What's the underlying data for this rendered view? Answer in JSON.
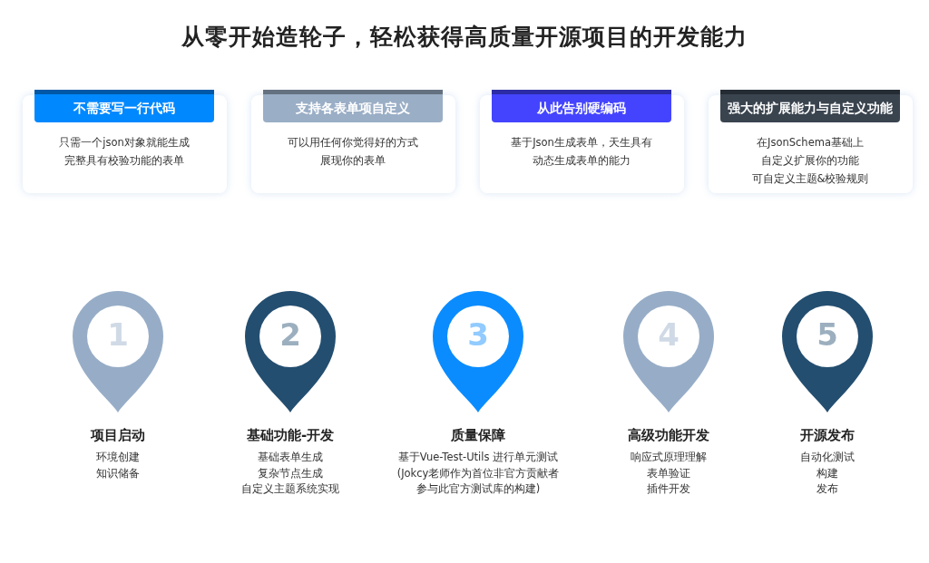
{
  "title": "从零开始造轮子，轻松获得高质量开源项目的开发能力",
  "features": [
    {
      "heading": "不需要写一行代码",
      "color": "#0088ff",
      "lines": [
        "只需一个json对象就能生成",
        "完整具有校验功能的表单"
      ]
    },
    {
      "heading": "支持各表单项自定义",
      "color": "#9aaec6",
      "lines": [
        "可以用任何你觉得好的方式",
        "展现你的表单"
      ]
    },
    {
      "heading": "从此告别硬编码",
      "color": "#4444ff",
      "lines": [
        "基于Json生成表单，天生具有",
        "动态生成表单的能力"
      ]
    },
    {
      "heading": "强大的扩展能力与自定义功能",
      "color": "#3a444f",
      "lines": [
        "在JsonSchema基础上",
        "自定义扩展你的功能",
        "可自定义主题&校验规则"
      ]
    }
  ],
  "steps": [
    {
      "number": "1",
      "color": "#97adc7",
      "title": "项目启动",
      "lines": [
        "环境创建",
        "知识储备"
      ]
    },
    {
      "number": "2",
      "color": "#234e70",
      "title": "基础功能-开发",
      "lines": [
        "基础表单生成",
        "复杂节点生成",
        "自定义主题系统实现"
      ]
    },
    {
      "number": "3",
      "color": "#0a8cff",
      "title": "质量保障",
      "lines": [
        "基于Vue-Test-Utils 进行单元测试",
        "(Jokcy老师作为首位非官方贡献者",
        "参与此官方测试库的构建)"
      ]
    },
    {
      "number": "4",
      "color": "#97adc7",
      "title": "高级功能开发",
      "lines": [
        "响应式原理理解",
        "表单验证",
        "插件开发"
      ]
    },
    {
      "number": "5",
      "color": "#234e70",
      "title": "开源发布",
      "lines": [
        "自动化测试",
        "构建",
        "发布"
      ]
    }
  ]
}
